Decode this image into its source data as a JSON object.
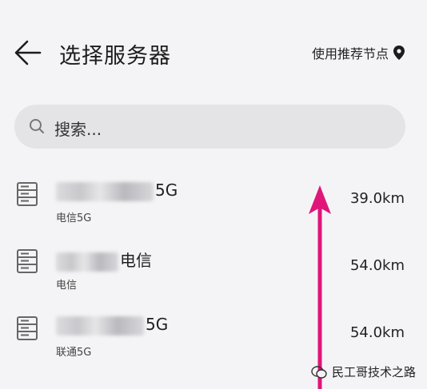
{
  "header": {
    "title": "选择服务器",
    "recommend_label": "使用推荐节点"
  },
  "search": {
    "placeholder": "搜索..."
  },
  "servers": [
    {
      "name_visible": "5G",
      "carrier": "电信5G",
      "distance": "39.0km"
    },
    {
      "name_visible": "电信",
      "carrier": "电信",
      "distance": "54.0km"
    },
    {
      "name_visible": "5G",
      "carrier": "联通5G",
      "distance": "54.0km"
    }
  ],
  "watermark": "民工哥技术之路",
  "colors": {
    "accent_arrow": "#e0157a",
    "background": "#f4f4f6",
    "search_bg": "#e4e4e7"
  }
}
